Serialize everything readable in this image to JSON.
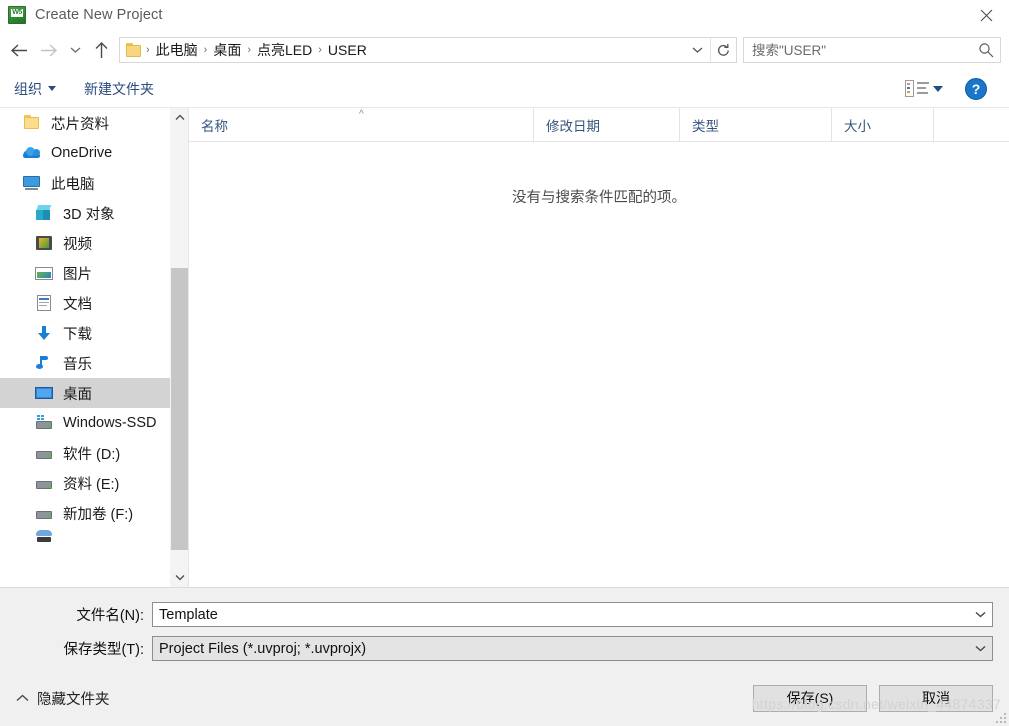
{
  "window": {
    "title": "Create New Project",
    "icon": "uvision-app-icon",
    "close_label": "✕"
  },
  "navigation": {
    "back": "←",
    "forward": "→",
    "recent": "⌄",
    "up": "↑"
  },
  "address": {
    "folder_icon": "folder-icon",
    "separator": "›",
    "crumbs": [
      "此电脑",
      "桌面",
      "点亮LED",
      "USER"
    ],
    "dropdown": "⌄",
    "refresh": "↻"
  },
  "search": {
    "placeholder": "搜索\"USER\"",
    "value": "",
    "icon": "search-icon"
  },
  "commandbar": {
    "organize": "组织",
    "new_folder": "新建文件夹",
    "view_icon": "list-view-icon",
    "view_caret": "▾",
    "help": "?"
  },
  "sidebar": {
    "items": [
      {
        "label": "芯片资料",
        "icon": "folder-icon",
        "indent": false,
        "selected": false
      },
      {
        "label": "OneDrive",
        "icon": "onedrive-cloud-icon",
        "indent": false,
        "selected": false
      },
      {
        "label": "此电脑",
        "icon": "this-pc-monitor-icon",
        "indent": false,
        "selected": false
      },
      {
        "label": "3D 对象",
        "icon": "3d-objects-cube-icon",
        "indent": true,
        "selected": false
      },
      {
        "label": "视频",
        "icon": "videos-film-icon",
        "indent": true,
        "selected": false
      },
      {
        "label": "图片",
        "icon": "pictures-icon",
        "indent": true,
        "selected": false
      },
      {
        "label": "文档",
        "icon": "documents-icon",
        "indent": true,
        "selected": false
      },
      {
        "label": "下载",
        "icon": "downloads-arrow-icon",
        "indent": true,
        "selected": false
      },
      {
        "label": "音乐",
        "icon": "music-note-icon",
        "indent": true,
        "selected": false
      },
      {
        "label": "桌面",
        "icon": "desktop-icon",
        "indent": true,
        "selected": true
      },
      {
        "label": "Windows-SSD",
        "icon": "windows-drive-icon",
        "indent": true,
        "selected": false
      },
      {
        "label": "软件 (D:)",
        "icon": "drive-icon",
        "indent": true,
        "selected": false
      },
      {
        "label": "资料 (E:)",
        "icon": "drive-icon",
        "indent": true,
        "selected": false
      },
      {
        "label": "新加卷 (F:)",
        "icon": "drive-icon",
        "indent": true,
        "selected": false
      }
    ],
    "scroll_up": "⌃",
    "scroll_down": "⌄"
  },
  "filelist": {
    "columns": [
      {
        "key": "name",
        "label": "名称",
        "sorted": true,
        "sort_caret": "^"
      },
      {
        "key": "date",
        "label": "修改日期"
      },
      {
        "key": "type",
        "label": "类型"
      },
      {
        "key": "size",
        "label": "大小"
      }
    ],
    "rows": [],
    "empty_message": "没有与搜索条件匹配的项。"
  },
  "form": {
    "filename_label": "文件名(N):",
    "filename_value": "Template",
    "filetype_label": "保存类型(T):",
    "filetype_value": "Project Files (*.uvproj; *.uvprojx)",
    "dropdown_glyph": "⌄"
  },
  "footer": {
    "hide_folders_caret": "⌃",
    "hide_folders_label": "隐藏文件夹",
    "save_label": "保存(S)",
    "cancel_label": "取消",
    "watermark": "https://blog.csdn.net/weixin_44874337"
  },
  "colors": {
    "accent_blue": "#1976c8",
    "command_text": "#2b4c7e",
    "column_header_text": "#36557f",
    "selection_gray": "#d3d3d3",
    "form_bg": "#f0f0f0",
    "folder_yellow": "#fbdd8a"
  }
}
